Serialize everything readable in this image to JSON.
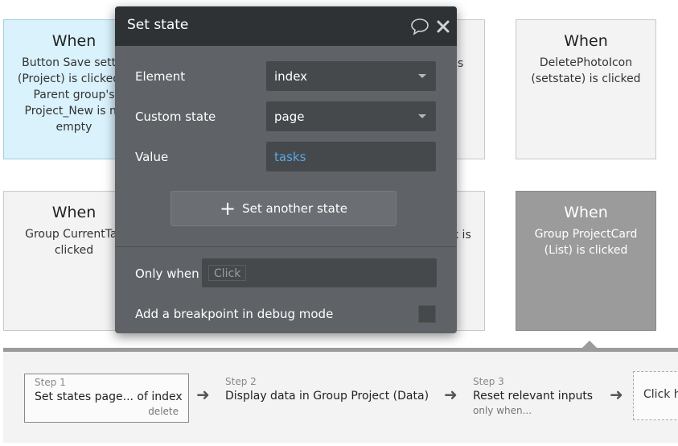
{
  "cards": {
    "when_label": "When",
    "top_left": [
      "Button Save settin",
      "(Project) is clicked a",
      "Parent group's",
      "Project_New is no",
      "empty"
    ],
    "top_middle_partial": "s",
    "top_right": [
      "DeletePhotoIcon",
      "(setstate) is clicked"
    ],
    "bottom_left": [
      "Group CurrentTas",
      "clicked"
    ],
    "bottom_middle_partial": "k is",
    "bottom_right": [
      "Group ProjectCard",
      "(List) is clicked"
    ]
  },
  "modal": {
    "title": "Set state",
    "element_label": "Element",
    "element_value": "index",
    "custom_state_label": "Custom state",
    "custom_state_value": "page",
    "value_label": "Value",
    "value_value": "tasks",
    "set_another_label": "Set another state",
    "only_when_label": "Only when",
    "only_when_chip": "Click",
    "breakpoint_label": "Add a breakpoint in debug mode"
  },
  "steps": [
    {
      "num": "Step 1",
      "label": "Set states page... of index",
      "sub": "delete"
    },
    {
      "num": "Step 2",
      "label": "Display data in Group Project (Data)",
      "sub": ""
    },
    {
      "num": "Step 3",
      "label": "Reset relevant inputs",
      "sub": "only when..."
    }
  ],
  "add_step_label": "Click h",
  "colors": {
    "modal_bg": "#5f6266",
    "modal_header": "#2f3234",
    "value_link": "#5aa7e6",
    "selected_card": "#d9f2fc",
    "dark_card": "#9b9b9b"
  }
}
